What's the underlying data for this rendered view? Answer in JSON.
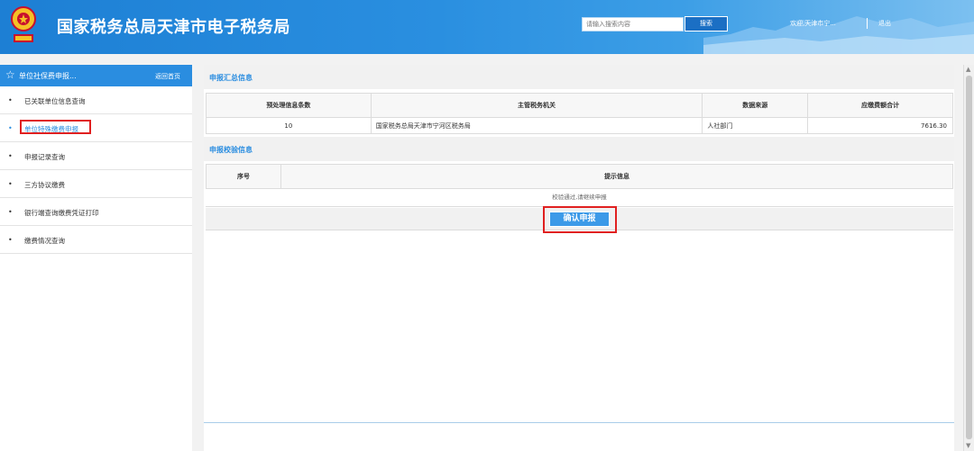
{
  "header": {
    "title": "国家税务总局天津市电子税务局",
    "search_placeholder": "请输入搜索内容",
    "search_button": "搜索",
    "welcome": "欢迎,天津市宁...",
    "logout": "退出",
    "colors": {
      "brand_blue": "#2a8de0",
      "highlight_red": "#e02020"
    }
  },
  "sidebar": {
    "title": "单位社保费申报...",
    "home_link": "返回首页",
    "items": [
      {
        "label": "已关联单位信息查询"
      },
      {
        "label": "单位特殊缴费申报",
        "active": true
      },
      {
        "label": "申报记录查询"
      },
      {
        "label": "三方协议缴费"
      },
      {
        "label": "银行端查询缴费凭证打印"
      },
      {
        "label": "缴费情况查询"
      }
    ]
  },
  "summary": {
    "section_title": "申报汇总信息",
    "columns": [
      "预处理信息条数",
      "主管税务机关",
      "数据来源",
      "应缴费额合计"
    ],
    "row": [
      "10",
      "国家税务总局天津市宁河区税务局",
      "人社部门",
      "7616.30"
    ]
  },
  "validation": {
    "section_title": "申报校验信息",
    "columns": [
      "序号",
      "提示信息"
    ],
    "message": "校验通过,请继续申报",
    "confirm_button": "确认申报"
  }
}
